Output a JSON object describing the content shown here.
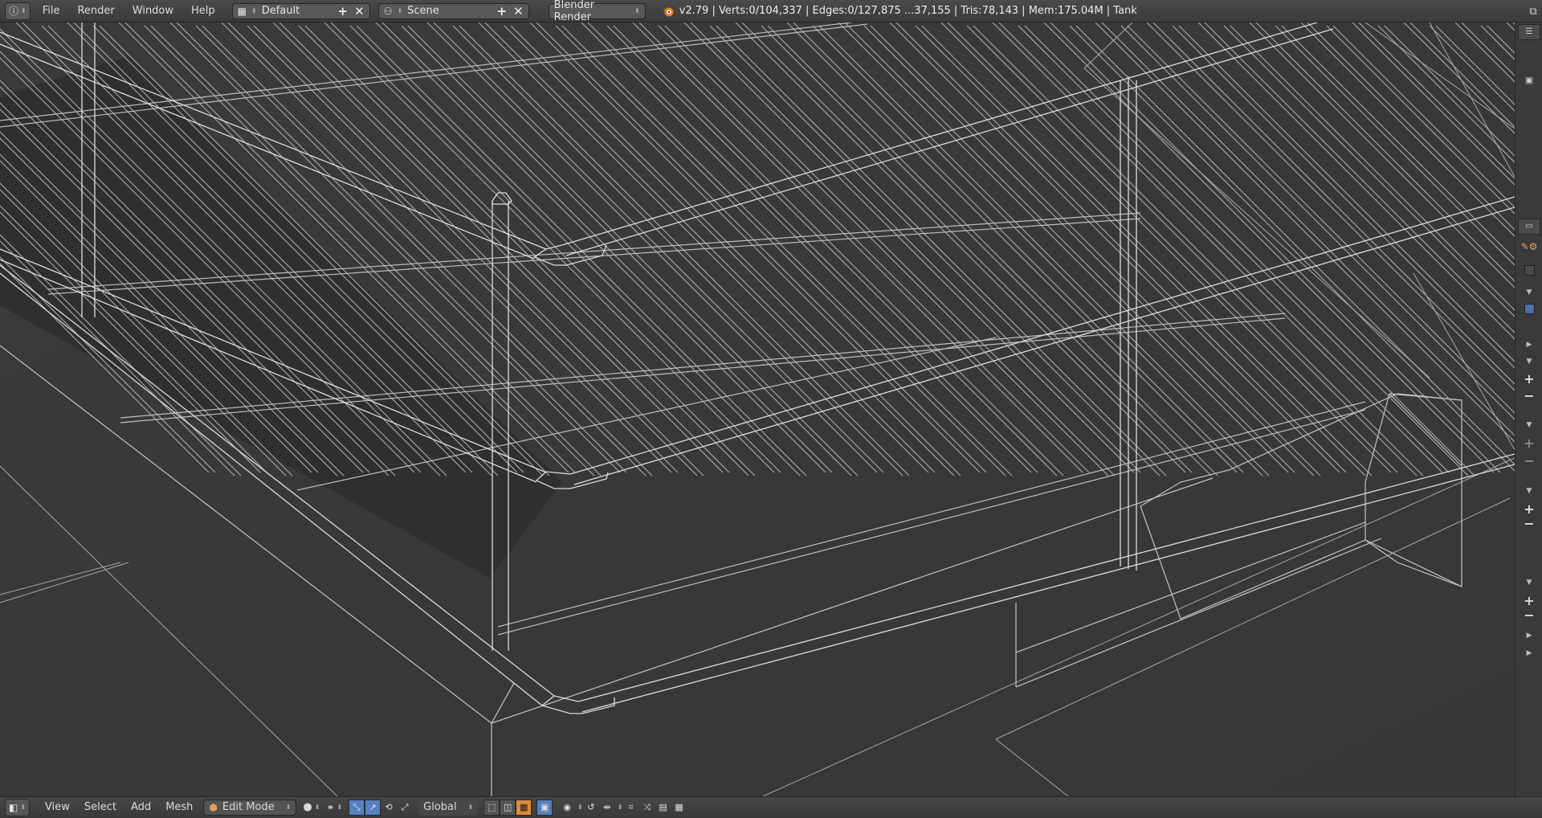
{
  "top_bar": {
    "editor_icon": "info-icon",
    "menus": [
      "File",
      "Render",
      "Window",
      "Help"
    ],
    "screen_layout": "Default",
    "scene": "Scene",
    "render_engine": "Blender Render",
    "stats": "v2.79 | Verts:0/104,337 | Edges:0/127,875 ...37,155 | Tris:78,143 | Mem:175.04M | Tank"
  },
  "viewport": {
    "view": "3D View (wireframe)",
    "mesh": "Tank walkway with handrails"
  },
  "side_strip": {
    "items": [
      "tab",
      "tab",
      "box",
      "tri",
      "checkbox",
      "tri",
      "tri",
      "plus",
      "tri",
      "plus",
      "minus",
      "tri",
      "plus",
      "minus",
      "tri",
      "plus",
      "minus",
      "tri",
      "tri"
    ]
  },
  "bottom_bar": {
    "editor_icon": "3d-view-icon",
    "menus": [
      "View",
      "Select",
      "Add",
      "Mesh"
    ],
    "mode": "Edit Mode",
    "transform_orientation": "Global",
    "accent": "#5680c2",
    "active_orange": "#e0893c"
  }
}
